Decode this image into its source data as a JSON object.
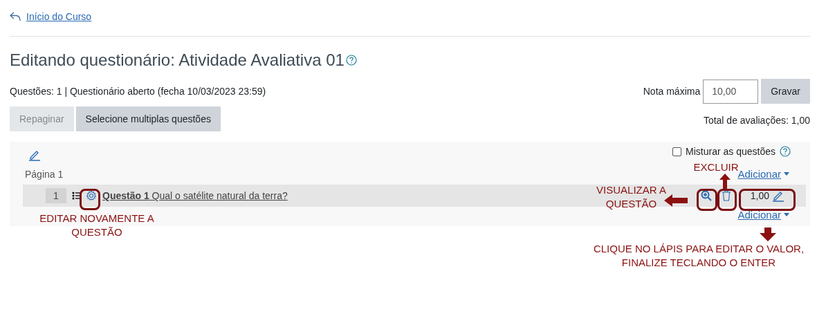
{
  "back_link": {
    "label": "Início do Curso"
  },
  "title": "Editando questionário: Atividade Avaliativa 01",
  "summary": "Questões: 1 | Questionário aberto (fecha 10/03/2023 23:59)",
  "max_grade": {
    "label": "Nota máxima",
    "value": "10,00",
    "button": "Gravar"
  },
  "buttons": [
    {
      "label": "Repaginar",
      "disabled": true
    },
    {
      "label": "Selecione multiplas questões",
      "disabled": false
    }
  ],
  "total": "Total de avaliações: 1,00",
  "shuffle": {
    "label": "Misturar as questões",
    "checked": false
  },
  "pages": [
    {
      "label": "Página 1",
      "add_top": "Adicionar",
      "add_bottom": "Adicionar",
      "questions": [
        {
          "number": "1",
          "name": "Questão 1",
          "text": "Qual o satélite natural da terra?",
          "mark": "1,00"
        }
      ]
    }
  ],
  "annotations": [
    {
      "kind": "edit",
      "text": "EDITAR NOVAMENTE A QUESTÃO"
    },
    {
      "kind": "preview",
      "text": "VISUALIZAR A QUESTÃO"
    },
    {
      "kind": "delete",
      "text": "EXCLUIR"
    },
    {
      "kind": "mark",
      "text": "CLIQUE NO LÁPIS PARA EDITAR O VALOR, FINALIZE TECLANDO O ENTER"
    }
  ]
}
